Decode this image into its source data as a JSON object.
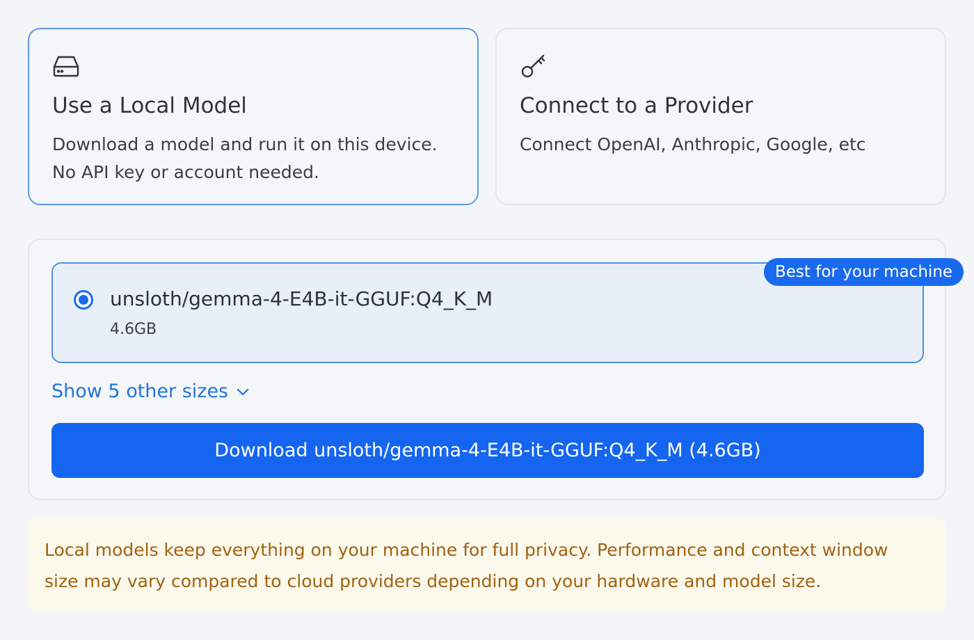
{
  "choices": {
    "local": {
      "icon": "hard-drive-icon",
      "title": "Use a Local Model",
      "desc_line1": "Download a model and run it on this device.",
      "desc_line2": "No API key or account needed.",
      "selected": true
    },
    "provider": {
      "icon": "key-icon",
      "title": "Connect to a Provider",
      "desc_line1": "Connect OpenAI, Anthropic, Google, etc",
      "selected": false
    }
  },
  "model": {
    "name": "unsloth/gemma-4-E4B-it-GGUF:Q4_K_M",
    "size": "4.6GB",
    "badge": "Best for your machine",
    "selected": true
  },
  "show_sizes": {
    "label": "Show 5 other sizes",
    "icon": "chevron-down-icon"
  },
  "download": {
    "label": "Download unsloth/gemma-4-E4B-it-GGUF:Q4_K_M (4.6GB)"
  },
  "notice": {
    "line1": "Local models keep everything on your machine for full privacy. Performance and context window",
    "line2": "size may vary compared to cloud providers depending on your hardware and model size."
  },
  "colors": {
    "accent": "#1565f0",
    "link": "#2474db",
    "selected_border": "#5b9ae3",
    "notice_text": "#a1620f",
    "notice_bg": "#fbf8ec"
  }
}
